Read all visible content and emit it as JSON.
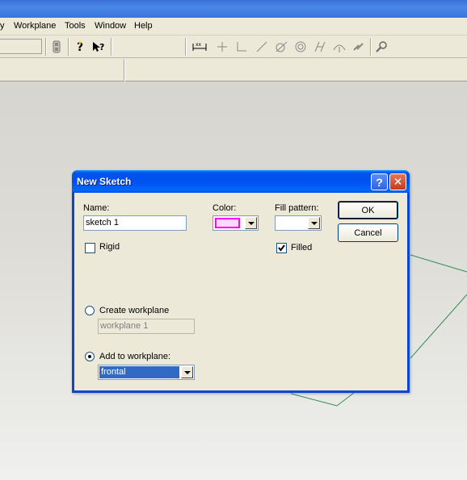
{
  "menubar": {
    "items": [
      "y",
      "Workplane",
      "Tools",
      "Window",
      "Help"
    ]
  },
  "toolbar": {
    "icons": [
      "tool-slot-icon",
      "help-icon",
      "whats-this-icon",
      "dimension-icon",
      "perpendicular-icon",
      "angle-icon",
      "line-icon",
      "tangent-icon",
      "circle-icon",
      "parallel-icon",
      "curve-icon",
      "chain-icon",
      "search-icon"
    ]
  },
  "dialog": {
    "title": "New Sketch",
    "help_symbol": "?",
    "close_symbol": "✕",
    "name_label": "Name:",
    "name_value": "sketch 1",
    "color_label": "Color:",
    "color_value": "#ff00ff",
    "fill_pattern_label": "Fill pattern:",
    "fill_pattern_value": "",
    "ok_label": "OK",
    "cancel_label": "Cancel",
    "rigid_label": "Rigid",
    "rigid_checked": false,
    "filled_label": "Filled",
    "filled_checked": true,
    "create_workplane_label": "Create workplane",
    "create_workplane_value": "workplane 1",
    "add_to_workplane_label": "Add to workplane:",
    "add_to_workplane_value": "frontal",
    "selected_option": "add_to_workplane"
  },
  "colors": {
    "title_bar": "#0054e3",
    "dialog_bg": "#ece9d8",
    "selection": "#316ac5",
    "sketch_line": "#2e8b57"
  }
}
